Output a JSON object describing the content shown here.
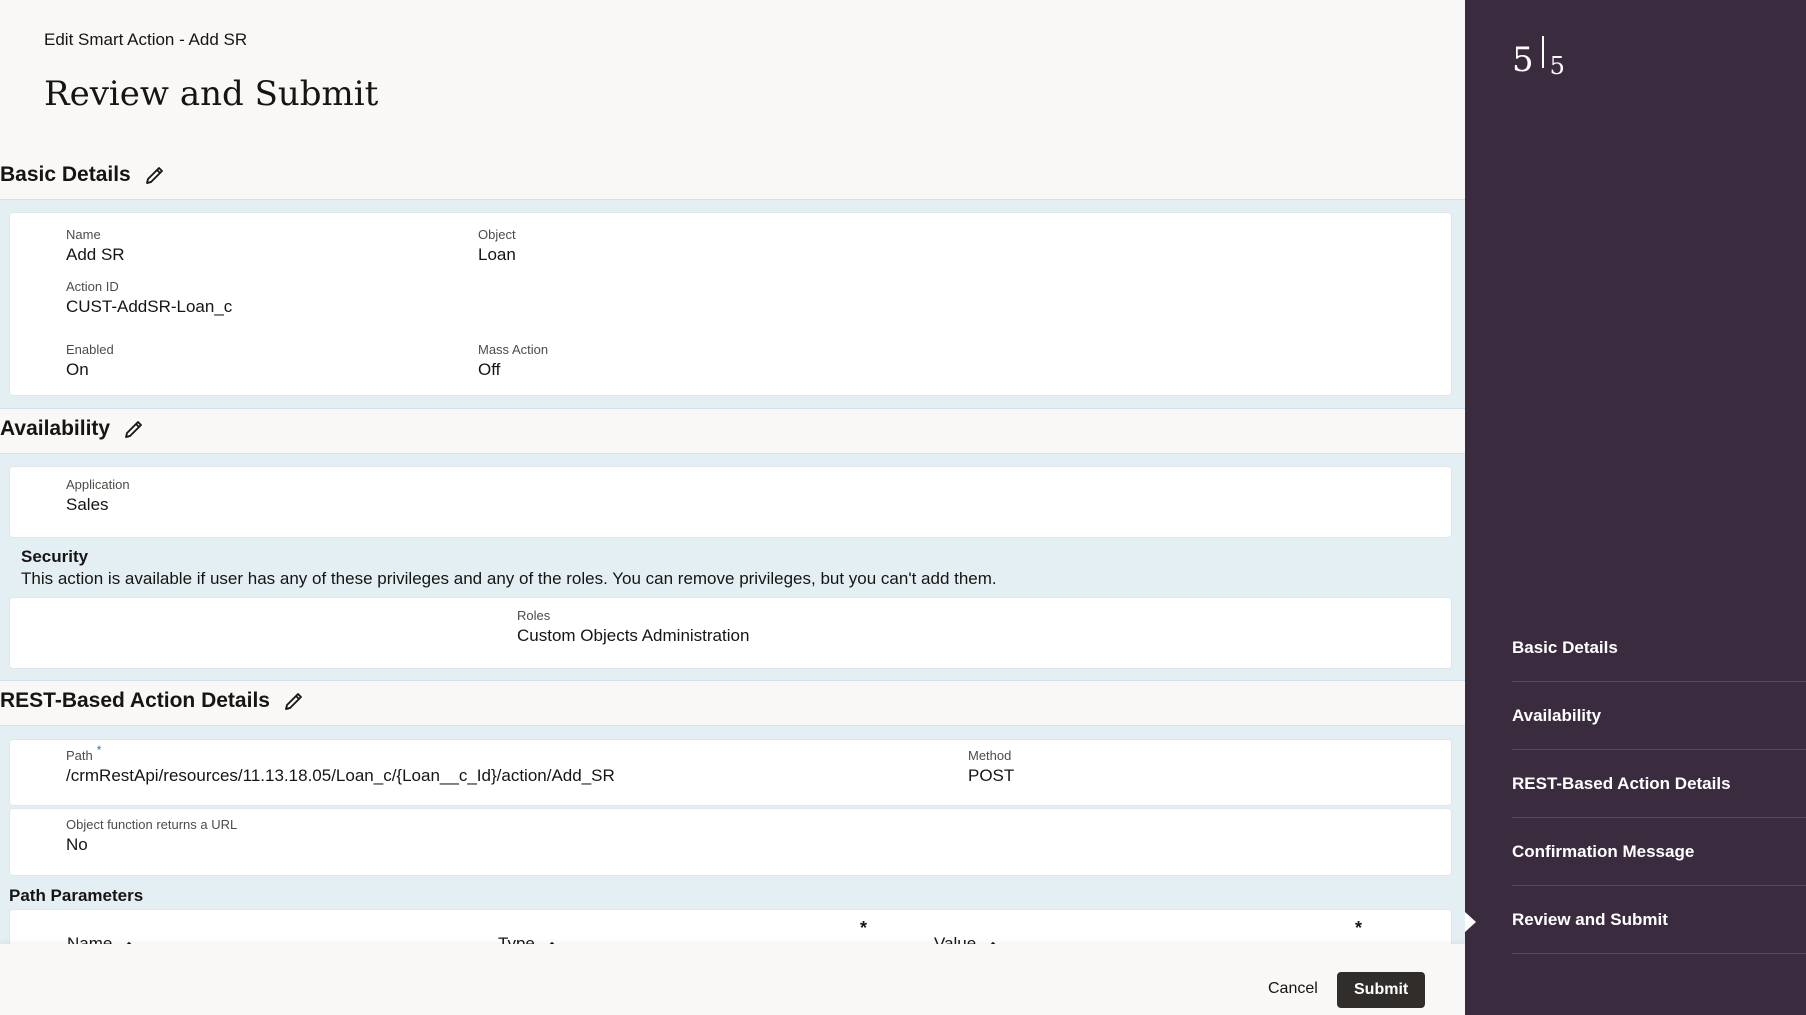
{
  "header": {
    "breadcrumb": "Edit Smart Action - Add SR",
    "title": "Review and Submit"
  },
  "basic_details": {
    "heading": "Basic Details",
    "name_label": "Name",
    "name_value": "Add SR",
    "object_label": "Object",
    "object_value": "Loan",
    "action_id_label": "Action ID",
    "action_id_value": "CUST-AddSR-Loan_c",
    "enabled_label": "Enabled",
    "enabled_value": "On",
    "mass_action_label": "Mass Action",
    "mass_action_value": "Off"
  },
  "availability": {
    "heading": "Availability",
    "application_label": "Application",
    "application_value": "Sales",
    "security_title": "Security",
    "security_text": "This action is available if user has any of these privileges and any of the roles. You can remove privileges, but you can't add them.",
    "roles_label": "Roles",
    "roles_value": "Custom Objects Administration"
  },
  "rest_details": {
    "heading": "REST-Based Action Details",
    "path_label": "Path",
    "path_required": "*",
    "path_value": "/crmRestApi/resources/11.13.18.05/Loan_c/{Loan__c_Id}/action/Add_SR",
    "method_label": "Method",
    "method_value": "POST",
    "returns_url_label": "Object function returns a URL",
    "returns_url_value": "No",
    "path_params_title": "Path Parameters",
    "columns": [
      "Name",
      "Type",
      "Value"
    ],
    "required_marker": "*"
  },
  "footer": {
    "cancel_label": "Cancel",
    "submit_label": "Submit"
  },
  "sidebar": {
    "current_step": "5",
    "total_steps": "5",
    "steps": [
      {
        "label": "Basic Details"
      },
      {
        "label": "Availability"
      },
      {
        "label": "REST-Based Action Details"
      },
      {
        "label": "Confirmation Message"
      },
      {
        "label": "Review and Submit"
      }
    ],
    "active_step": "Review and Submit"
  },
  "icons": {
    "edit": "pencil-icon",
    "sort": "chevron-up-icon",
    "current_step_indicator": "triangle-right-icon"
  },
  "colors": {
    "sidebar_bg": "#3a2b3e",
    "band_bg": "#e4eff4",
    "submit_bg": "#312d2a",
    "required_marker": "#227e9e"
  }
}
